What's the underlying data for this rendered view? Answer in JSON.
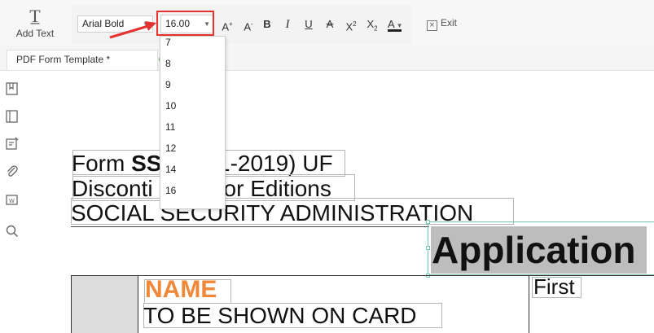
{
  "toolbar": {
    "add_text_label": "Add Text",
    "font_name": "Arial Bold",
    "font_size": "16.00",
    "buttons": [
      {
        "id": "increase-font",
        "glyph": "A",
        "mark": "+"
      },
      {
        "id": "decrease-font",
        "glyph": "A",
        "mark": "-"
      },
      {
        "id": "bold",
        "glyph": "B"
      },
      {
        "id": "italic",
        "glyph": "I"
      },
      {
        "id": "underline",
        "glyph": "U"
      },
      {
        "id": "strikethrough",
        "glyph": "A"
      },
      {
        "id": "superscript",
        "glyph": "X",
        "mark": "2"
      },
      {
        "id": "subscript",
        "glyph": "X",
        "mark": "2"
      },
      {
        "id": "font-color",
        "glyph": "A"
      }
    ],
    "exit_label": "Exit"
  },
  "tabs": [
    {
      "label": "PDF Form Template *"
    }
  ],
  "font_size_dropdown": {
    "options": [
      "7",
      "8",
      "9",
      "10",
      "11",
      "12",
      "14",
      "16"
    ]
  },
  "document": {
    "line1_prefix": "Form ",
    "line1_bold": "SS",
    "line1_rest": "1-2019) UF",
    "line2_left": "Disconti",
    "line2_right": "rior Editions",
    "line3": "SOCIAL SECURITY ADMINISTRATION",
    "heading": "Application",
    "name_label": "NAME",
    "name_sub": "TO BE SHOWN ON CARD",
    "first_label": "First"
  },
  "colors": {
    "highlight_red": "#e6322e",
    "name_orange": "#f0883a",
    "selection_teal": "#77c7b5",
    "heading_bg": "#bdbdbd"
  },
  "icons": {
    "rail": [
      "bookmark-icon",
      "page-thumbnail-icon",
      "comment-icon",
      "attachment-icon",
      "signature-icon",
      "search-icon"
    ]
  }
}
